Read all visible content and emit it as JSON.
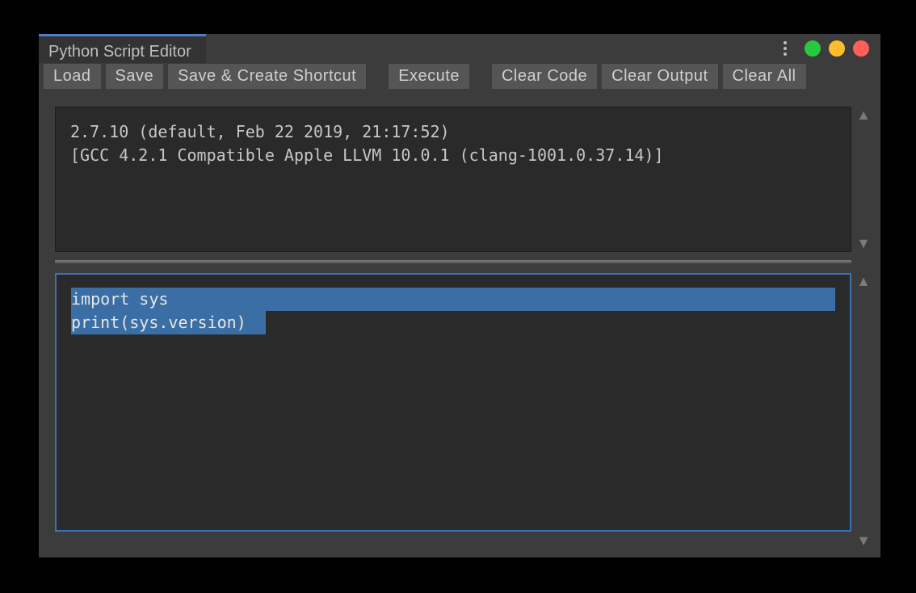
{
  "window": {
    "title": "Python Script Editor"
  },
  "toolbar": {
    "load": "Load",
    "save": "Save",
    "save_shortcut": "Save & Create Shortcut",
    "execute": "Execute",
    "clear_code": "Clear Code",
    "clear_output": "Clear Output",
    "clear_all": "Clear All"
  },
  "output": {
    "text": "2.7.10 (default, Feb 22 2019, 21:17:52) \n[GCC 4.2.1 Compatible Apple LLVM 10.0.1 (clang-1001.0.37.14)]"
  },
  "code": {
    "line1": "import sys",
    "line2": "print(sys.version)"
  }
}
